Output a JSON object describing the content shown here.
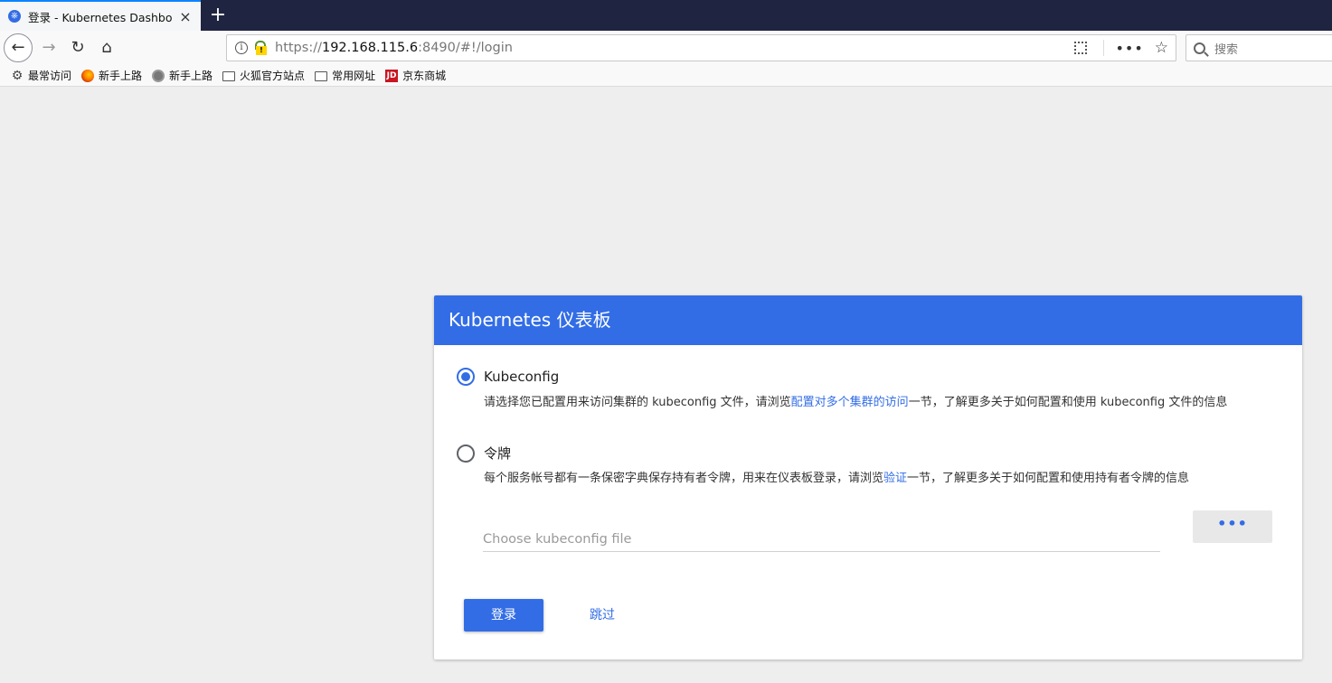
{
  "browser": {
    "tab": {
      "title": "登录 - Kubernetes Dashboard",
      "close": "×",
      "icon": "kubernetes-icon"
    },
    "new_tab": "+",
    "url": {
      "scheme": "https://",
      "host": "192.168.115.6",
      "rest": ":8490/#!/login"
    },
    "search_placeholder": "搜索",
    "bookmarks": [
      {
        "label": "最常访问",
        "icon": "gear-icon"
      },
      {
        "label": "新手上路",
        "icon": "firefox-icon"
      },
      {
        "label": "新手上路",
        "icon": "globe-icon"
      },
      {
        "label": "火狐官方站点",
        "icon": "folder-icon"
      },
      {
        "label": "常用网址",
        "icon": "folder-icon"
      },
      {
        "label": "京东商城",
        "icon": "jd-icon",
        "icon_text": "JD"
      }
    ]
  },
  "login": {
    "title": "Kubernetes 仪表板",
    "options": {
      "kubeconfig": {
        "label": "Kubeconfig",
        "selected": true,
        "desc_before": "请选择您已配置用来访问集群的 kubeconfig 文件，请浏览",
        "desc_link": "配置对多个集群的访问",
        "desc_after": "一节，了解更多关于如何配置和使用 kubeconfig 文件的信息"
      },
      "token": {
        "label": "令牌",
        "selected": false,
        "desc_before": "每个服务帐号都有一条保密字典保存持有者令牌，用来在仪表板登录，请浏览",
        "desc_link": "验证",
        "desc_after": "一节，了解更多关于如何配置和使用持有者令牌的信息"
      }
    },
    "file_placeholder": "Choose kubeconfig file",
    "browse_label": "•••",
    "login_label": "登录",
    "skip_label": "跳过"
  },
  "colors": {
    "accent": "#326de6",
    "tabstrip": "#1f2440"
  }
}
